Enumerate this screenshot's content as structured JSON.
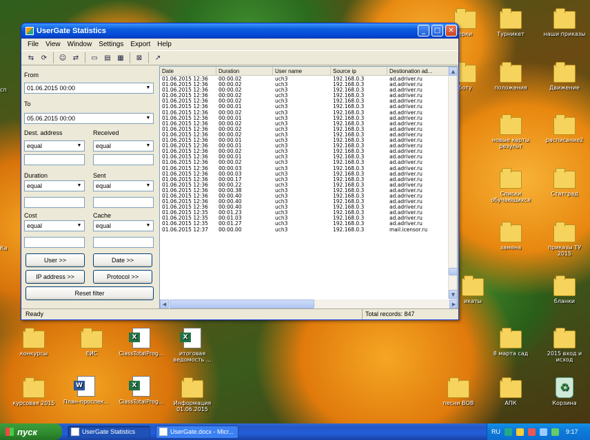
{
  "window": {
    "title": "UserGate Statistics",
    "menu": [
      "File",
      "View",
      "Window",
      "Settings",
      "Export",
      "Help"
    ],
    "status_left": "Ready",
    "status_right": "Total records: 847"
  },
  "filter": {
    "from_label": "From",
    "from_value": "01.06.2015 00:00",
    "to_label": "To",
    "to_value": "05.06.2015 00:00",
    "dest_label": "Dest. address",
    "received_label": "Received",
    "duration_label": "Duration",
    "sent_label": "Sent",
    "cost_label": "Cost",
    "cache_label": "Cache",
    "op": "equal",
    "user_btn": "User >>",
    "date_btn": "Date >>",
    "ip_btn": "IP address >>",
    "protocol_btn": "Protocol >>",
    "reset_btn": "Reset filter"
  },
  "table": {
    "columns": [
      "Date",
      "Duration",
      "User name",
      "Source ip",
      "Destionation ad..."
    ],
    "rows": [
      [
        "01.06.2015 12:36",
        "00:00.02",
        "uch3",
        "192.168.0.3",
        "ad.adriver.ru"
      ],
      [
        "01.06.2015 12:36",
        "00:00.02",
        "uch3",
        "192.168.0.3",
        "ad.adriver.ru"
      ],
      [
        "01.06.2015 12:36",
        "00:00.02",
        "uch3",
        "192.168.0.3",
        "ad.adriver.ru"
      ],
      [
        "01.06.2015 12:36",
        "00:00.02",
        "uch3",
        "192.168.0.3",
        "ad.adriver.ru"
      ],
      [
        "01.06.2015 12:36",
        "00:00.02",
        "uch3",
        "192.168.0.3",
        "ad.adriver.ru"
      ],
      [
        "01.06.2015 12:36",
        "00:00.01",
        "uch3",
        "192.168.0.3",
        "ad.adriver.ru"
      ],
      [
        "01.06.2015 12:36",
        "00:00.02",
        "uch3",
        "192.168.0.3",
        "ad.adriver.ru"
      ],
      [
        "01.06.2015 12:36",
        "00:00.01",
        "uch3",
        "192.168.0.3",
        "ad.adriver.ru"
      ],
      [
        "01.06.2015 12:36",
        "00:00.02",
        "uch3",
        "192.168.0.3",
        "ad.adriver.ru"
      ],
      [
        "01.06.2015 12:36",
        "00:00.02",
        "uch3",
        "192.168.0.3",
        "ad.adriver.ru"
      ],
      [
        "01.06.2015 12:36",
        "00:00.02",
        "uch3",
        "192.168.0.3",
        "ad.adriver.ru"
      ],
      [
        "01.06.2015 12:36",
        "00:00.01",
        "uch3",
        "192.168.0.3",
        "ad.adriver.ru"
      ],
      [
        "01.06.2015 12:36",
        "00:00.01",
        "uch3",
        "192.168.0.3",
        "ad.adriver.ru"
      ],
      [
        "01.06.2015 12:36",
        "00:00.02",
        "uch3",
        "192.168.0.3",
        "ad.adriver.ru"
      ],
      [
        "01.06.2015 12:36",
        "00:00.01",
        "uch3",
        "192.168.0.3",
        "ad.adriver.ru"
      ],
      [
        "01.06.2015 12:36",
        "00:00.02",
        "uch3",
        "192.168.0.3",
        "ad.adriver.ru"
      ],
      [
        "01.06.2015 12:36",
        "00:00.03",
        "uch3",
        "192.168.0.3",
        "ad.adriver.ru"
      ],
      [
        "01.06.2015 12:36",
        "00:00.03",
        "uch3",
        "192.168.0.3",
        "ad.adriver.ru"
      ],
      [
        "01.06.2015 12:36",
        "00:00.17",
        "uch3",
        "192.168.0.3",
        "ad.adriver.ru"
      ],
      [
        "01.06.2015 12:36",
        "00:00.22",
        "uch3",
        "192.168.0.3",
        "ad.adriver.ru"
      ],
      [
        "01.06.2015 12:36",
        "00:00.38",
        "uch3",
        "192.168.0.3",
        "ad.adriver.ru"
      ],
      [
        "01.06.2015 12:36",
        "00:00.40",
        "uch3",
        "192.168.0.3",
        "ad.adriver.ru"
      ],
      [
        "01.06.2015 12:36",
        "00:00.40",
        "uch3",
        "192.168.0.3",
        "ad.adriver.ru"
      ],
      [
        "01.06.2015 12:36",
        "00:00.40",
        "uch3",
        "192.168.0.3",
        "ad.adriver.ru"
      ],
      [
        "01.06.2015 12:35",
        "00:01.23",
        "uch3",
        "192.168.0.3",
        "ad.adriver.ru"
      ],
      [
        "01.06.2015 12:35",
        "00:01.03",
        "uch3",
        "192.168.0.3",
        "ad.adriver.ru"
      ],
      [
        "01.06.2015 12:35",
        "00:01.27",
        "uch3",
        "192.168.0.3",
        "ad.adriver.ru"
      ],
      [
        "01.06.2015 12:37",
        "00:00.00",
        "uch3",
        "192.168.0.3",
        "mail.icensor.ru"
      ]
    ]
  },
  "desktop": {
    "icons": [
      "ерки",
      "Турникет",
      "наши приказы",
      "боту",
      "положения",
      "Движение",
      "новые карты результ",
      "расписание2",
      "Списки обучающихся",
      "Статград",
      "замена",
      "приказы ТУ 2015",
      "икаты",
      "бланки",
      "конкурсы",
      "ЕИС",
      "ClassTotalProg...",
      "итоговая ведомость ...",
      "8 марта сад",
      "2015 вход и исход",
      "курсовая 2015",
      "План-проспек...",
      "ClassTotalProg...",
      "Информация 01.06.2015",
      "песни ВОВ",
      "АПК",
      "Корзина",
      "сп",
      "Ка"
    ]
  },
  "taskbar": {
    "start": "пуск",
    "tasks": [
      "UserGate Statistics",
      "UserGate.docx - Micr..."
    ],
    "lang": "RU",
    "clock": "9:17"
  },
  "colors": {
    "titlebar": "#0a5bdc",
    "taskbar": "#245edb",
    "start": "#2f8a2f"
  }
}
